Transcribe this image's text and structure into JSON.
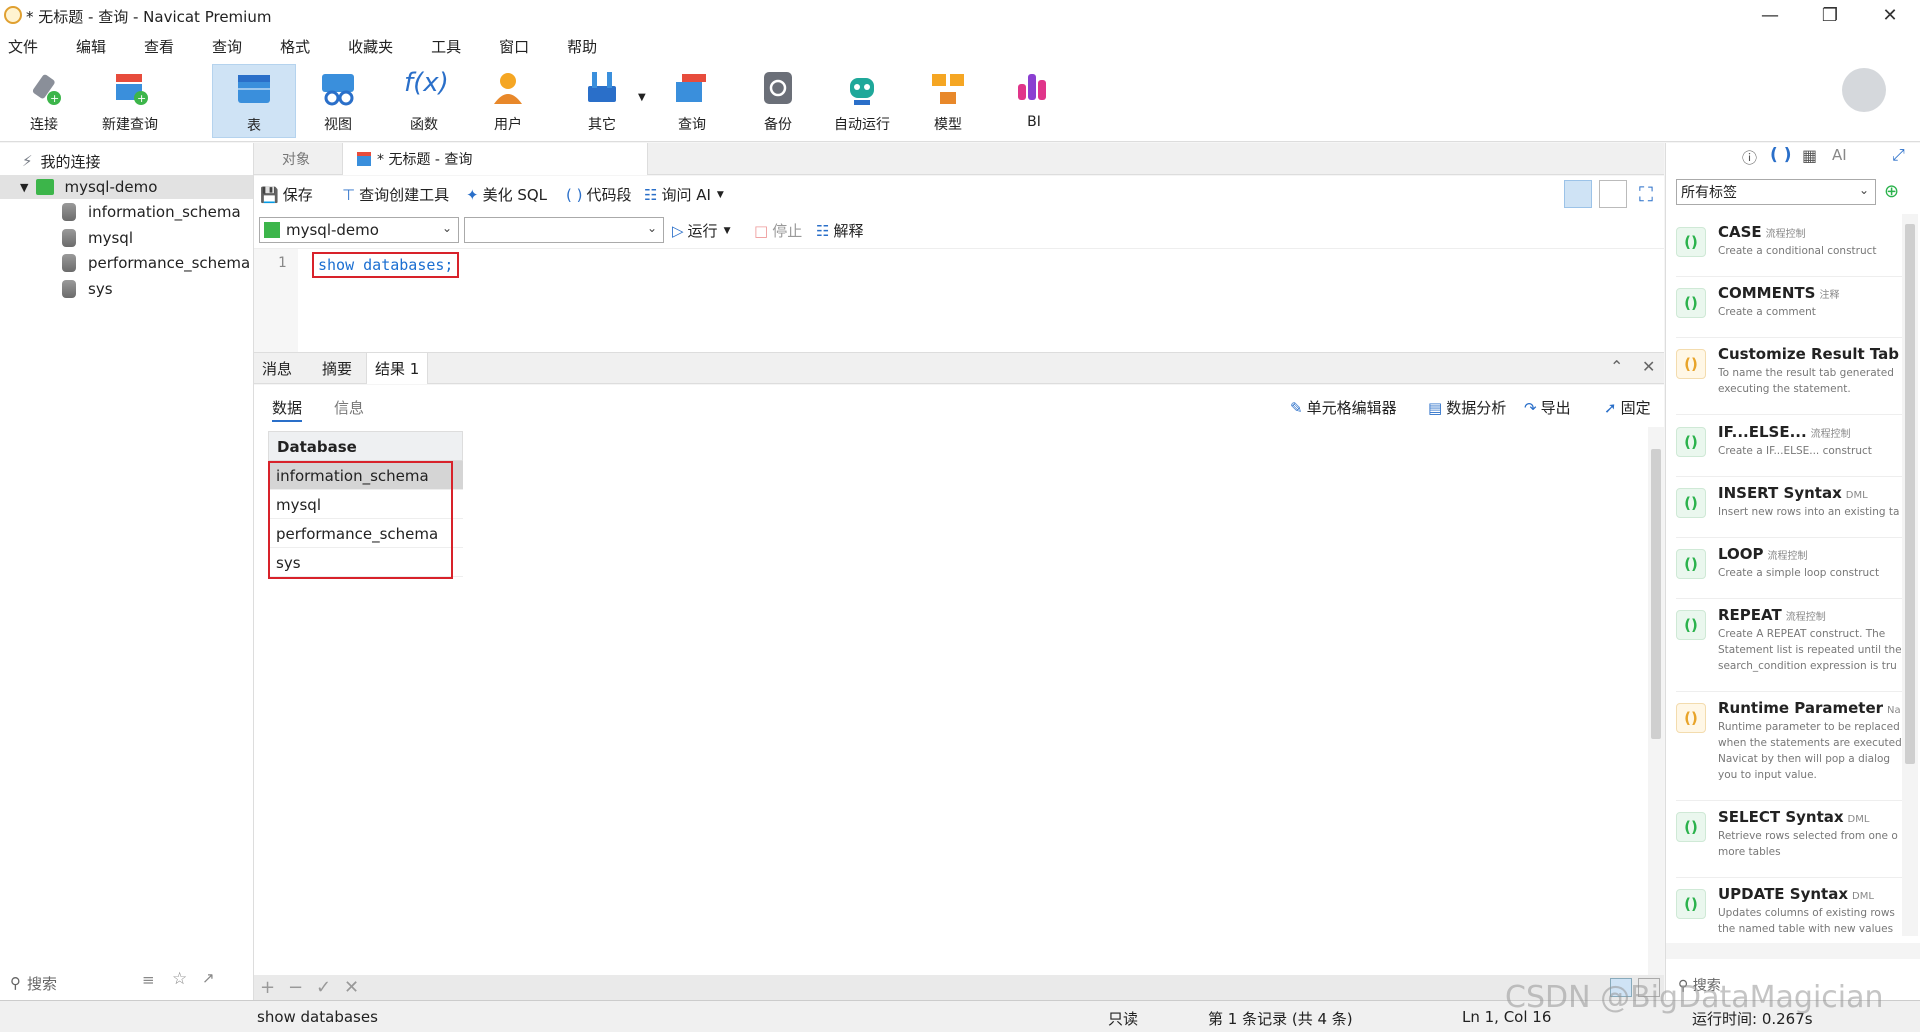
{
  "window": {
    "title": "* 无标题 - 查询 - Navicat Premium"
  },
  "menu": [
    "文件",
    "编辑",
    "查看",
    "查询",
    "格式",
    "收藏夹",
    "工具",
    "窗口",
    "帮助"
  ],
  "toolbar": [
    "连接",
    "新建查询",
    "表",
    "视图",
    "函数",
    "用户",
    "其它",
    "查询",
    "备份",
    "自动运行",
    "模型",
    "BI"
  ],
  "nav": {
    "header": "我的连接",
    "connection": "mysql-demo",
    "databases": [
      "information_schema",
      "mysql",
      "performance_schema",
      "sys"
    ],
    "search_placeholder": "搜索"
  },
  "tabs": {
    "objects": "对象",
    "query": "* 无标题 - 查询"
  },
  "query_toolbar": {
    "save": "保存",
    "builder": "查询创建工具",
    "beautify": "美化 SQL",
    "snippet": "代码段",
    "ask_ai": "询问 AI"
  },
  "run_bar": {
    "connection": "mysql-demo",
    "database": "",
    "run": "运行",
    "stop": "停止",
    "explain": "解释"
  },
  "editor": {
    "line": "1",
    "code": "show databases;"
  },
  "result_tabs": [
    "消息",
    "摘要",
    "结果 1"
  ],
  "result_subtabs": {
    "data": "数据",
    "info": "信息"
  },
  "result_actions": {
    "cell_editor": "单元格编辑器",
    "analysis": "数据分析",
    "export": "导出",
    "pin": "固定"
  },
  "grid": {
    "column": "Database",
    "rows": [
      "information_schema",
      "mysql",
      "performance_schema",
      "sys"
    ]
  },
  "snippets": {
    "filter": "所有标签",
    "search_placeholder": "搜索",
    "items": [
      {
        "title": "CASE",
        "tag": "流程控制",
        "desc": "Create a conditional construct"
      },
      {
        "title": "COMMENTS",
        "tag": "注释",
        "desc": "Create a comment"
      },
      {
        "title": "Customize Result Tab",
        "tag": "",
        "desc": "To name the result tab generated executing the statement."
      },
      {
        "title": "IF...ELSE...",
        "tag": "流程控制",
        "desc": "Create a IF...ELSE... construct"
      },
      {
        "title": "INSERT Syntax",
        "tag": "DML",
        "desc": "Insert new rows into an existing ta"
      },
      {
        "title": "LOOP",
        "tag": "流程控制",
        "desc": "Create a simple loop construct"
      },
      {
        "title": "REPEAT",
        "tag": "流程控制",
        "desc": "Create A REPEAT construct. The Statement list is repeated until the search_condition expression is tru"
      },
      {
        "title": "Runtime Parameter",
        "tag": "Na",
        "desc": "Runtime parameter to be replaced when the statements are executed Navicat by then will pop a dialog you to input value."
      },
      {
        "title": "SELECT Syntax",
        "tag": "DML",
        "desc": "Retrieve rows selected from one o more tables"
      },
      {
        "title": "UPDATE Syntax",
        "tag": "DML",
        "desc": "Updates columns of existing rows the named table with new values"
      }
    ]
  },
  "status": {
    "sql": "show databases",
    "readonly": "只读",
    "records": "第 1 条记录 (共 4 条)",
    "cursor": "Ln 1, Col 16",
    "runtime": "运行时间: 0.267s"
  },
  "watermark": "CSDN @BigDataMagician",
  "colors": {
    "accent": "#2a6fc9",
    "highlight": "#d8222a",
    "active_tool": "#cfe3f5"
  }
}
